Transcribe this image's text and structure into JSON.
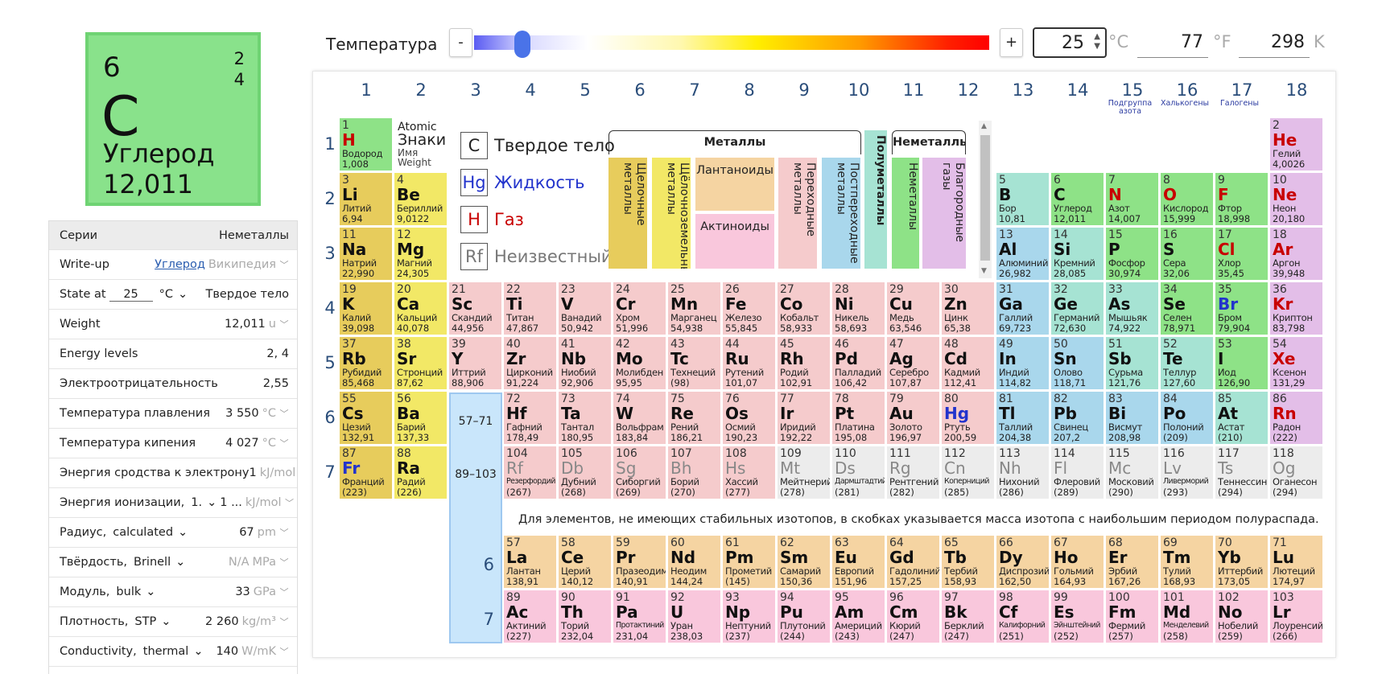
{
  "selected": {
    "number": "6",
    "shells": [
      "2",
      "4"
    ],
    "symbol": "C",
    "name": "Углерод",
    "weight": "12,011"
  },
  "temperature": {
    "label": "Температура",
    "minus": "-",
    "plus": "+",
    "celsius": "25",
    "celsius_unit": "°C",
    "fahrenheit": "77",
    "fahrenheit_unit": "°F",
    "kelvin": "298",
    "kelvin_unit": "K",
    "slider_fraction": 0.06
  },
  "props": {
    "series_label": "Серии",
    "series_value": "Неметаллы",
    "writeup_label": "Write-up",
    "writeup_link": "Углерод",
    "writeup_alt": "Википедия",
    "state_label": "State at",
    "state_temp": "25",
    "state_unit": "°C",
    "state_value": "Твердое тело",
    "weight_label": "Weight",
    "weight_value": "12,011",
    "weight_unit": "u",
    "energy_label": "Energy levels",
    "energy_value": "2, 4",
    "electroneg_label": "Электроотрицательность",
    "electroneg_value": "2,55",
    "melt_label": "Температура плавления",
    "melt_value": "3 550",
    "melt_unit": "°C",
    "boil_label": "Температура кипения",
    "boil_value": "4 027",
    "boil_unit": "°C",
    "affinity_label": "Энергия сродства к электрону",
    "affinity_value": "1",
    "affinity_unit": "kJ/mol",
    "ion_label": "Энергия ионизации,",
    "ion_select": "1.",
    "ion_value": "1 ...",
    "ion_unit": "kJ/mol",
    "radius_label": "Радиус,",
    "radius_select": "calculated",
    "radius_value": "67",
    "radius_unit": "pm",
    "hard_label": "Твёрдость,",
    "hard_select": "Brinell",
    "hard_value": "N/A",
    "hard_unit": "MPa",
    "mod_label": "Модуль,",
    "mod_select": "bulk",
    "mod_value": "33",
    "mod_unit": "GPa",
    "dens_label": "Плотность,",
    "dens_select": "STP",
    "dens_value": "2 260",
    "dens_unit": "kg/m³",
    "cond_label": "Conductivity,",
    "cond_select": "thermal",
    "cond_value": "140",
    "cond_unit": "W/mK"
  },
  "groups": [
    "1",
    "2",
    "3",
    "4",
    "5",
    "6",
    "7",
    "8",
    "9",
    "10",
    "11",
    "12",
    "13",
    "14",
    "15",
    "16",
    "17",
    "18"
  ],
  "group_subs": {
    "g15": "Подгруппа азота",
    "g16": "Халькогены",
    "g17": "Галогены"
  },
  "periods": [
    "1",
    "2",
    "3",
    "4",
    "5",
    "6",
    "7"
  ],
  "key": {
    "number": "1",
    "symbol": "H",
    "name": "Водород",
    "weight": "1,008",
    "atomic": "Atomic",
    "znaki": "Знаки",
    "imya": "Имя",
    "weight_lbl": "Weight"
  },
  "legend": {
    "solid": "Твердое тело",
    "liquid": "Жидкость",
    "gas": "Газ",
    "unknown": "Неизвестный",
    "solid_sym": "C",
    "liquid_sym": "Hg",
    "gas_sym": "H",
    "unknown_sym": "Rf"
  },
  "categories": {
    "metals": "Металлы",
    "nonmetals": "Неметаллы",
    "alkali": "Щелочные металлы",
    "alkaline_earth": "Щёлочноземельные металлы",
    "lanthanoids": "Лантаноиды",
    "actinoids": "Актиноиды",
    "transition": "Переходные металлы",
    "post_transition": "Постпереходные металлы",
    "metalloids": "Полуметаллы",
    "nonmetal": "Неметаллы",
    "noble": "Благородные газы"
  },
  "f_ref": {
    "lan": "57–71",
    "act": "89–103",
    "p6": "6",
    "p7": "7"
  },
  "note": "Для элементов, не имеющих стабильных изотопов, в скобках указывается масса изотопа с наибольшим периодом полураспада.",
  "elements": [
    {
      "n": "2",
      "s": "He",
      "nm": "Гелий",
      "w": "4,0026",
      "g": 18,
      "p": 1,
      "c": "ng",
      "st": "gas"
    },
    {
      "n": "3",
      "s": "Li",
      "nm": "Литий",
      "w": "6,94",
      "g": 1,
      "p": 2,
      "c": "alk"
    },
    {
      "n": "4",
      "s": "Be",
      "nm": "Бериллий",
      "w": "9,0122",
      "g": 2,
      "p": 2,
      "c": "ae"
    },
    {
      "n": "5",
      "s": "B",
      "nm": "Бор",
      "w": "10,81",
      "g": 13,
      "p": 2,
      "c": "met"
    },
    {
      "n": "6",
      "s": "C",
      "nm": "Углерод",
      "w": "12,011",
      "g": 14,
      "p": 2,
      "c": "nm"
    },
    {
      "n": "7",
      "s": "N",
      "nm": "Азот",
      "w": "14,007",
      "g": 15,
      "p": 2,
      "c": "nm",
      "st": "gas"
    },
    {
      "n": "8",
      "s": "O",
      "nm": "Кислород",
      "w": "15,999",
      "g": 16,
      "p": 2,
      "c": "nm",
      "st": "gas"
    },
    {
      "n": "9",
      "s": "F",
      "nm": "Фтор",
      "w": "18,998",
      "g": 17,
      "p": 2,
      "c": "nm",
      "st": "gas"
    },
    {
      "n": "10",
      "s": "Ne",
      "nm": "Неон",
      "w": "20,180",
      "g": 18,
      "p": 2,
      "c": "ng",
      "st": "gas"
    },
    {
      "n": "11",
      "s": "Na",
      "nm": "Натрий",
      "w": "22,990",
      "g": 1,
      "p": 3,
      "c": "alk"
    },
    {
      "n": "12",
      "s": "Mg",
      "nm": "Магний",
      "w": "24,305",
      "g": 2,
      "p": 3,
      "c": "ae"
    },
    {
      "n": "13",
      "s": "Al",
      "nm": "Алюминий",
      "w": "26,982",
      "g": 13,
      "p": 3,
      "c": "ptm"
    },
    {
      "n": "14",
      "s": "Si",
      "nm": "Кремний",
      "w": "28,085",
      "g": 14,
      "p": 3,
      "c": "met"
    },
    {
      "n": "15",
      "s": "P",
      "nm": "Фосфор",
      "w": "30,974",
      "g": 15,
      "p": 3,
      "c": "nm"
    },
    {
      "n": "16",
      "s": "S",
      "nm": "Сера",
      "w": "32,06",
      "g": 16,
      "p": 3,
      "c": "nm"
    },
    {
      "n": "17",
      "s": "Cl",
      "nm": "Хлор",
      "w": "35,45",
      "g": 17,
      "p": 3,
      "c": "nm",
      "st": "gas"
    },
    {
      "n": "18",
      "s": "Ar",
      "nm": "Аргон",
      "w": "39,948",
      "g": 18,
      "p": 3,
      "c": "ng",
      "st": "gas"
    },
    {
      "n": "19",
      "s": "K",
      "nm": "Калий",
      "w": "39,098",
      "g": 1,
      "p": 4,
      "c": "alk"
    },
    {
      "n": "20",
      "s": "Ca",
      "nm": "Кальций",
      "w": "40,078",
      "g": 2,
      "p": 4,
      "c": "ae"
    },
    {
      "n": "21",
      "s": "Sc",
      "nm": "Скандий",
      "w": "44,956",
      "g": 3,
      "p": 4,
      "c": "tm"
    },
    {
      "n": "22",
      "s": "Ti",
      "nm": "Титан",
      "w": "47,867",
      "g": 4,
      "p": 4,
      "c": "tm"
    },
    {
      "n": "23",
      "s": "V",
      "nm": "Ванадий",
      "w": "50,942",
      "g": 5,
      "p": 4,
      "c": "tm"
    },
    {
      "n": "24",
      "s": "Cr",
      "nm": "Хром",
      "w": "51,996",
      "g": 6,
      "p": 4,
      "c": "tm"
    },
    {
      "n": "25",
      "s": "Mn",
      "nm": "Марганец",
      "w": "54,938",
      "g": 7,
      "p": 4,
      "c": "tm"
    },
    {
      "n": "26",
      "s": "Fe",
      "nm": "Железо",
      "w": "55,845",
      "g": 8,
      "p": 4,
      "c": "tm"
    },
    {
      "n": "27",
      "s": "Co",
      "nm": "Кобальт",
      "w": "58,933",
      "g": 9,
      "p": 4,
      "c": "tm"
    },
    {
      "n": "28",
      "s": "Ni",
      "nm": "Никель",
      "w": "58,693",
      "g": 10,
      "p": 4,
      "c": "tm"
    },
    {
      "n": "29",
      "s": "Cu",
      "nm": "Медь",
      "w": "63,546",
      "g": 11,
      "p": 4,
      "c": "tm"
    },
    {
      "n": "30",
      "s": "Zn",
      "nm": "Цинк",
      "w": "65,38",
      "g": 12,
      "p": 4,
      "c": "tm"
    },
    {
      "n": "31",
      "s": "Ga",
      "nm": "Галлий",
      "w": "69,723",
      "g": 13,
      "p": 4,
      "c": "ptm"
    },
    {
      "n": "32",
      "s": "Ge",
      "nm": "Германий",
      "w": "72,630",
      "g": 14,
      "p": 4,
      "c": "met"
    },
    {
      "n": "33",
      "s": "As",
      "nm": "Мышьяк",
      "w": "74,922",
      "g": 15,
      "p": 4,
      "c": "met"
    },
    {
      "n": "34",
      "s": "Se",
      "nm": "Селен",
      "w": "78,971",
      "g": 16,
      "p": 4,
      "c": "nm"
    },
    {
      "n": "35",
      "s": "Br",
      "nm": "Бром",
      "w": "79,904",
      "g": 17,
      "p": 4,
      "c": "nm",
      "st": "liq"
    },
    {
      "n": "36",
      "s": "Kr",
      "nm": "Криптон",
      "w": "83,798",
      "g": 18,
      "p": 4,
      "c": "ng",
      "st": "gas"
    },
    {
      "n": "37",
      "s": "Rb",
      "nm": "Рубидий",
      "w": "85,468",
      "g": 1,
      "p": 5,
      "c": "alk"
    },
    {
      "n": "38",
      "s": "Sr",
      "nm": "Стронций",
      "w": "87,62",
      "g": 2,
      "p": 5,
      "c": "ae"
    },
    {
      "n": "39",
      "s": "Y",
      "nm": "Иттрий",
      "w": "88,906",
      "g": 3,
      "p": 5,
      "c": "tm"
    },
    {
      "n": "40",
      "s": "Zr",
      "nm": "Цирконий",
      "w": "91,224",
      "g": 4,
      "p": 5,
      "c": "tm"
    },
    {
      "n": "41",
      "s": "Nb",
      "nm": "Ниобий",
      "w": "92,906",
      "g": 5,
      "p": 5,
      "c": "tm"
    },
    {
      "n": "42",
      "s": "Mo",
      "nm": "Молибден",
      "w": "95,95",
      "g": 6,
      "p": 5,
      "c": "tm"
    },
    {
      "n": "43",
      "s": "Tc",
      "nm": "Технеций",
      "w": "(98)",
      "g": 7,
      "p": 5,
      "c": "tm"
    },
    {
      "n": "44",
      "s": "Ru",
      "nm": "Рутений",
      "w": "101,07",
      "g": 8,
      "p": 5,
      "c": "tm"
    },
    {
      "n": "45",
      "s": "Rh",
      "nm": "Родий",
      "w": "102,91",
      "g": 9,
      "p": 5,
      "c": "tm"
    },
    {
      "n": "46",
      "s": "Pd",
      "nm": "Палладий",
      "w": "106,42",
      "g": 10,
      "p": 5,
      "c": "tm"
    },
    {
      "n": "47",
      "s": "Ag",
      "nm": "Серебро",
      "w": "107,87",
      "g": 11,
      "p": 5,
      "c": "tm"
    },
    {
      "n": "48",
      "s": "Cd",
      "nm": "Кадмий",
      "w": "112,41",
      "g": 12,
      "p": 5,
      "c": "tm"
    },
    {
      "n": "49",
      "s": "In",
      "nm": "Индий",
      "w": "114,82",
      "g": 13,
      "p": 5,
      "c": "ptm"
    },
    {
      "n": "50",
      "s": "Sn",
      "nm": "Олово",
      "w": "118,71",
      "g": 14,
      "p": 5,
      "c": "ptm"
    },
    {
      "n": "51",
      "s": "Sb",
      "nm": "Сурьма",
      "w": "121,76",
      "g": 15,
      "p": 5,
      "c": "met"
    },
    {
      "n": "52",
      "s": "Te",
      "nm": "Теллур",
      "w": "127,60",
      "g": 16,
      "p": 5,
      "c": "met"
    },
    {
      "n": "53",
      "s": "I",
      "nm": "Иод",
      "w": "126,90",
      "g": 17,
      "p": 5,
      "c": "nm"
    },
    {
      "n": "54",
      "s": "Xe",
      "nm": "Ксенон",
      "w": "131,29",
      "g": 18,
      "p": 5,
      "c": "ng",
      "st": "gas"
    },
    {
      "n": "55",
      "s": "Cs",
      "nm": "Цезий",
      "w": "132,91",
      "g": 1,
      "p": 6,
      "c": "alk"
    },
    {
      "n": "56",
      "s": "Ba",
      "nm": "Барий",
      "w": "137,33",
      "g": 2,
      "p": 6,
      "c": "ae"
    },
    {
      "n": "72",
      "s": "Hf",
      "nm": "Гафний",
      "w": "178,49",
      "g": 4,
      "p": 6,
      "c": "tm"
    },
    {
      "n": "73",
      "s": "Ta",
      "nm": "Тантал",
      "w": "180,95",
      "g": 5,
      "p": 6,
      "c": "tm"
    },
    {
      "n": "74",
      "s": "W",
      "nm": "Вольфрам",
      "w": "183,84",
      "g": 6,
      "p": 6,
      "c": "tm"
    },
    {
      "n": "75",
      "s": "Re",
      "nm": "Рений",
      "w": "186,21",
      "g": 7,
      "p": 6,
      "c": "tm"
    },
    {
      "n": "76",
      "s": "Os",
      "nm": "Осмий",
      "w": "190,23",
      "g": 8,
      "p": 6,
      "c": "tm"
    },
    {
      "n": "77",
      "s": "Ir",
      "nm": "Иридий",
      "w": "192,22",
      "g": 9,
      "p": 6,
      "c": "tm"
    },
    {
      "n": "78",
      "s": "Pt",
      "nm": "Платина",
      "w": "195,08",
      "g": 10,
      "p": 6,
      "c": "tm"
    },
    {
      "n": "79",
      "s": "Au",
      "nm": "Золото",
      "w": "196,97",
      "g": 11,
      "p": 6,
      "c": "tm"
    },
    {
      "n": "80",
      "s": "Hg",
      "nm": "Ртуть",
      "w": "200,59",
      "g": 12,
      "p": 6,
      "c": "tm",
      "st": "liq"
    },
    {
      "n": "81",
      "s": "Tl",
      "nm": "Таллий",
      "w": "204,38",
      "g": 13,
      "p": 6,
      "c": "ptm"
    },
    {
      "n": "82",
      "s": "Pb",
      "nm": "Свинец",
      "w": "207,2",
      "g": 14,
      "p": 6,
      "c": "ptm"
    },
    {
      "n": "83",
      "s": "Bi",
      "nm": "Висмут",
      "w": "208,98",
      "g": 15,
      "p": 6,
      "c": "ptm"
    },
    {
      "n": "84",
      "s": "Po",
      "nm": "Полоний",
      "w": "(209)",
      "g": 16,
      "p": 6,
      "c": "ptm"
    },
    {
      "n": "85",
      "s": "At",
      "nm": "Астат",
      "w": "(210)",
      "g": 17,
      "p": 6,
      "c": "met"
    },
    {
      "n": "86",
      "s": "Rn",
      "nm": "Радон",
      "w": "(222)",
      "g": 18,
      "p": 6,
      "c": "ng",
      "st": "gas"
    },
    {
      "n": "87",
      "s": "Fr",
      "nm": "Франций",
      "w": "(223)",
      "g": 1,
      "p": 7,
      "c": "alk",
      "st": "liq"
    },
    {
      "n": "88",
      "s": "Ra",
      "nm": "Радий",
      "w": "(226)",
      "g": 2,
      "p": 7,
      "c": "ae"
    },
    {
      "n": "104",
      "s": "Rf",
      "nm": "Резерфордий",
      "w": "(267)",
      "g": 4,
      "p": 7,
      "c": "tm",
      "st": "unk"
    },
    {
      "n": "105",
      "s": "Db",
      "nm": "Дубний",
      "w": "(268)",
      "g": 5,
      "p": 7,
      "c": "tm",
      "st": "unk"
    },
    {
      "n": "106",
      "s": "Sg",
      "nm": "Сиборгий",
      "w": "(269)",
      "g": 6,
      "p": 7,
      "c": "tm",
      "st": "unk"
    },
    {
      "n": "107",
      "s": "Bh",
      "nm": "Борий",
      "w": "(270)",
      "g": 7,
      "p": 7,
      "c": "tm",
      "st": "unk"
    },
    {
      "n": "108",
      "s": "Hs",
      "nm": "Хассий",
      "w": "(277)",
      "g": 8,
      "p": 7,
      "c": "tm",
      "st": "unk"
    },
    {
      "n": "109",
      "s": "Mt",
      "nm": "Мейтнерий",
      "w": "(278)",
      "g": 9,
      "p": 7,
      "c": "unk",
      "st": "unk"
    },
    {
      "n": "110",
      "s": "Ds",
      "nm": "Дармштадтий",
      "w": "(281)",
      "g": 10,
      "p": 7,
      "c": "unk",
      "st": "unk"
    },
    {
      "n": "111",
      "s": "Rg",
      "nm": "Рентгений",
      "w": "(282)",
      "g": 11,
      "p": 7,
      "c": "unk",
      "st": "unk"
    },
    {
      "n": "112",
      "s": "Cn",
      "nm": "Коперниций",
      "w": "(285)",
      "g": 12,
      "p": 7,
      "c": "unk",
      "st": "unk"
    },
    {
      "n": "113",
      "s": "Nh",
      "nm": "Нихоний",
      "w": "(286)",
      "g": 13,
      "p": 7,
      "c": "unk",
      "st": "unk"
    },
    {
      "n": "114",
      "s": "Fl",
      "nm": "Флеровий",
      "w": "(289)",
      "g": 14,
      "p": 7,
      "c": "unk",
      "st": "unk"
    },
    {
      "n": "115",
      "s": "Mc",
      "nm": "Московий",
      "w": "(290)",
      "g": 15,
      "p": 7,
      "c": "unk",
      "st": "unk"
    },
    {
      "n": "116",
      "s": "Lv",
      "nm": "Ливерморий",
      "w": "(293)",
      "g": 16,
      "p": 7,
      "c": "unk",
      "st": "unk"
    },
    {
      "n": "117",
      "s": "Ts",
      "nm": "Теннессин",
      "w": "(294)",
      "g": 17,
      "p": 7,
      "c": "unk",
      "st": "unk"
    },
    {
      "n": "118",
      "s": "Og",
      "nm": "Оганесон",
      "w": "(294)",
      "g": 18,
      "p": 7,
      "c": "unk",
      "st": "unk"
    },
    {
      "n": "57",
      "s": "La",
      "nm": "Лантан",
      "w": "138,91",
      "g": 4,
      "p": 9,
      "c": "lan"
    },
    {
      "n": "58",
      "s": "Ce",
      "nm": "Церий",
      "w": "140,12",
      "g": 5,
      "p": 9,
      "c": "lan"
    },
    {
      "n": "59",
      "s": "Pr",
      "nm": "Празеодим",
      "w": "140,91",
      "g": 6,
      "p": 9,
      "c": "lan"
    },
    {
      "n": "60",
      "s": "Nd",
      "nm": "Неодим",
      "w": "144,24",
      "g": 7,
      "p": 9,
      "c": "lan"
    },
    {
      "n": "61",
      "s": "Pm",
      "nm": "Прометий",
      "w": "(145)",
      "g": 8,
      "p": 9,
      "c": "lan"
    },
    {
      "n": "62",
      "s": "Sm",
      "nm": "Самарий",
      "w": "150,36",
      "g": 9,
      "p": 9,
      "c": "lan"
    },
    {
      "n": "63",
      "s": "Eu",
      "nm": "Европий",
      "w": "151,96",
      "g": 10,
      "p": 9,
      "c": "lan"
    },
    {
      "n": "64",
      "s": "Gd",
      "nm": "Гадолиний",
      "w": "157,25",
      "g": 11,
      "p": 9,
      "c": "lan"
    },
    {
      "n": "65",
      "s": "Tb",
      "nm": "Тербий",
      "w": "158,93",
      "g": 12,
      "p": 9,
      "c": "lan"
    },
    {
      "n": "66",
      "s": "Dy",
      "nm": "Диспрозий",
      "w": "162,50",
      "g": 13,
      "p": 9,
      "c": "lan"
    },
    {
      "n": "67",
      "s": "Ho",
      "nm": "Гольмий",
      "w": "164,93",
      "g": 14,
      "p": 9,
      "c": "lan"
    },
    {
      "n": "68",
      "s": "Er",
      "nm": "Эрбий",
      "w": "167,26",
      "g": 15,
      "p": 9,
      "c": "lan"
    },
    {
      "n": "69",
      "s": "Tm",
      "nm": "Тулий",
      "w": "168,93",
      "g": 16,
      "p": 9,
      "c": "lan"
    },
    {
      "n": "70",
      "s": "Yb",
      "nm": "Иттербий",
      "w": "173,05",
      "g": 17,
      "p": 9,
      "c": "lan"
    },
    {
      "n": "71",
      "s": "Lu",
      "nm": "Лютеций",
      "w": "174,97",
      "g": 18,
      "p": 9,
      "c": "lan"
    },
    {
      "n": "89",
      "s": "Ac",
      "nm": "Актиний",
      "w": "(227)",
      "g": 4,
      "p": 10,
      "c": "act"
    },
    {
      "n": "90",
      "s": "Th",
      "nm": "Торий",
      "w": "232,04",
      "g": 5,
      "p": 10,
      "c": "act"
    },
    {
      "n": "91",
      "s": "Pa",
      "nm": "Протактиний",
      "w": "231,04",
      "g": 6,
      "p": 10,
      "c": "act"
    },
    {
      "n": "92",
      "s": "U",
      "nm": "Уран",
      "w": "238,03",
      "g": 7,
      "p": 10,
      "c": "act"
    },
    {
      "n": "93",
      "s": "Np",
      "nm": "Нептуний",
      "w": "(237)",
      "g": 8,
      "p": 10,
      "c": "act"
    },
    {
      "n": "94",
      "s": "Pu",
      "nm": "Плутоний",
      "w": "(244)",
      "g": 9,
      "p": 10,
      "c": "act"
    },
    {
      "n": "95",
      "s": "Am",
      "nm": "Америций",
      "w": "(243)",
      "g": 10,
      "p": 10,
      "c": "act"
    },
    {
      "n": "96",
      "s": "Cm",
      "nm": "Кюрий",
      "w": "(247)",
      "g": 11,
      "p": 10,
      "c": "act"
    },
    {
      "n": "97",
      "s": "Bk",
      "nm": "Берклий",
      "w": "(247)",
      "g": 12,
      "p": 10,
      "c": "act"
    },
    {
      "n": "98",
      "s": "Cf",
      "nm": "Калифорний",
      "w": "(251)",
      "g": 13,
      "p": 10,
      "c": "act"
    },
    {
      "n": "99",
      "s": "Es",
      "nm": "Эйнштейний",
      "w": "(252)",
      "g": 14,
      "p": 10,
      "c": "act"
    },
    {
      "n": "100",
      "s": "Fm",
      "nm": "Фермий",
      "w": "(257)",
      "g": 15,
      "p": 10,
      "c": "act"
    },
    {
      "n": "101",
      "s": "Md",
      "nm": "Менделевий",
      "w": "(258)",
      "g": 16,
      "p": 10,
      "c": "act"
    },
    {
      "n": "102",
      "s": "No",
      "nm": "Нобелий",
      "w": "(259)",
      "g": 17,
      "p": 10,
      "c": "act"
    },
    {
      "n": "103",
      "s": "Lr",
      "nm": "Лоуренсий",
      "w": "(266)",
      "g": 18,
      "p": 10,
      "c": "act"
    }
  ]
}
